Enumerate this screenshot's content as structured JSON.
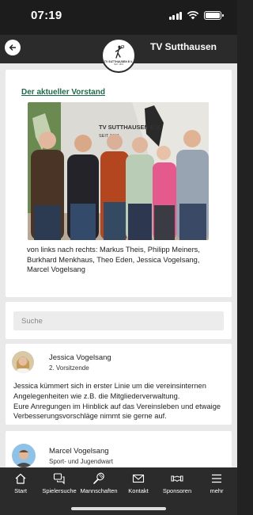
{
  "status_bar": {
    "time": "07:19"
  },
  "header": {
    "title": "TV Sutthausen",
    "logo_text": "TV SUTTHAUSEN E.V.",
    "logo_subtext": "SEIT 1881"
  },
  "board_card": {
    "heading": "Der aktueller Vorstand",
    "photo_sign_line1": "TV SUTTHAUSEN E.V.",
    "photo_sign_line2": "SEIT 1881",
    "caption": "von links nach rechts: Markus Theis, Philipp Meiners, Burkhard Menkhaus, Theo Eden, Jessica Vogelsang, Marcel Vogelsang"
  },
  "search": {
    "placeholder": "Suche"
  },
  "persons": [
    {
      "name": "Jessica Vogelsang",
      "role": "2. Vorsitzende",
      "description": "Jessica kümmert sich in erster Linie um die vereinsinternen Angelegenheiten wie z.B. die Mitgliederverwaltung.\nEure Anregungen im Hinblick auf das Vereinsleben und etwaige Verbesserungsvorschläge nimmt sie gerne auf."
    },
    {
      "name": "Marcel Vogelsang",
      "role": "Sport- und Jugendwart"
    }
  ],
  "tabs": [
    {
      "label": "Start",
      "icon": "home-icon"
    },
    {
      "label": "Spielersuche",
      "icon": "chat-icon"
    },
    {
      "label": "Mannschaften",
      "icon": "racket-icon"
    },
    {
      "label": "Kontakt",
      "icon": "mail-icon"
    },
    {
      "label": "Sponsoren",
      "icon": "handshake-icon"
    },
    {
      "label": "mehr",
      "icon": "menu-icon"
    }
  ],
  "colors": {
    "bars": "#2b2b2b",
    "background": "#e9e9e9",
    "heading_green": "#1f6a4a"
  }
}
